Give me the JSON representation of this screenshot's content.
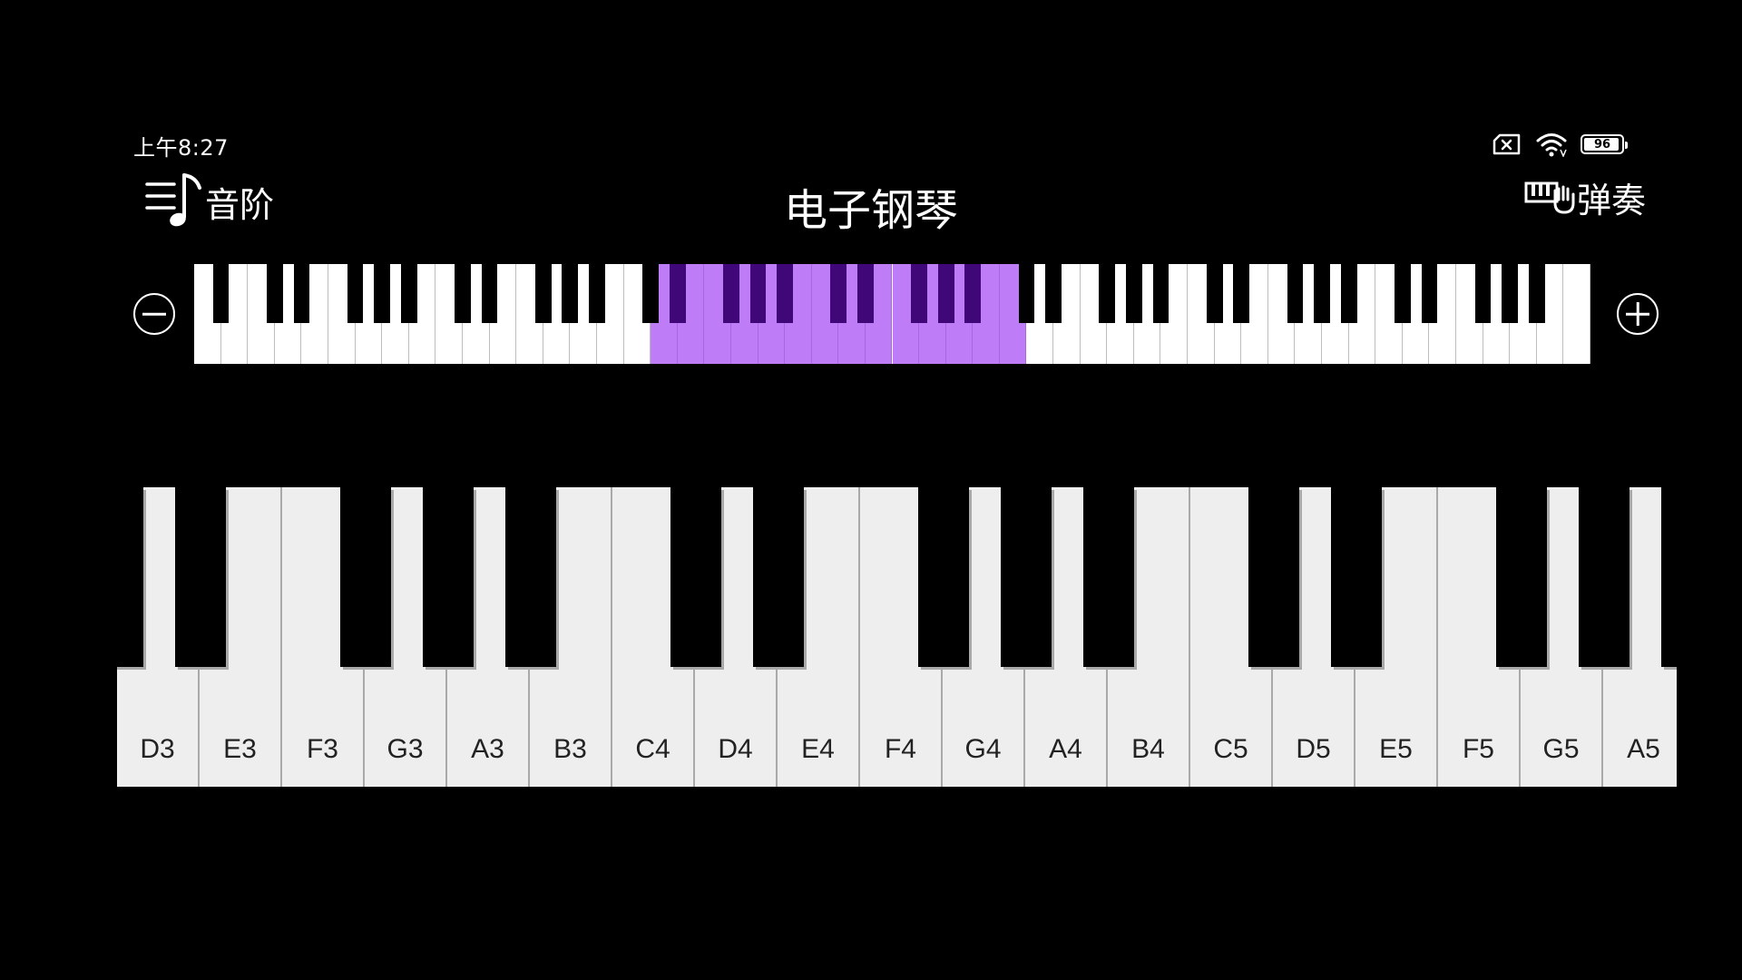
{
  "status_bar": {
    "time": "上午8:27",
    "battery_level": "96",
    "icons": [
      "sim-blocked-icon",
      "wifi-icon",
      "battery-icon"
    ]
  },
  "header": {
    "left_label": "音阶",
    "left_icon": "menu-music-note-icon",
    "title": "电子钢琴",
    "right_label": "弹奏",
    "right_icon": "piano-hand-icon"
  },
  "range_selector": {
    "minus_icon": "minus-circle-icon",
    "plus_icon": "plus-circle-icon",
    "highlight_color": "#bf7cf7",
    "highlight_black_color": "#3f0777",
    "highlight_start_white_index": 17,
    "highlight_white_count": 14
  },
  "keyboard": {
    "white_keys": [
      "D3",
      "E3",
      "F3",
      "G3",
      "A3",
      "B3",
      "C4",
      "D4",
      "E4",
      "F4",
      "G4",
      "A4",
      "B4",
      "C5",
      "D5",
      "E5",
      "F5",
      "G5",
      "A5",
      ""
    ]
  }
}
